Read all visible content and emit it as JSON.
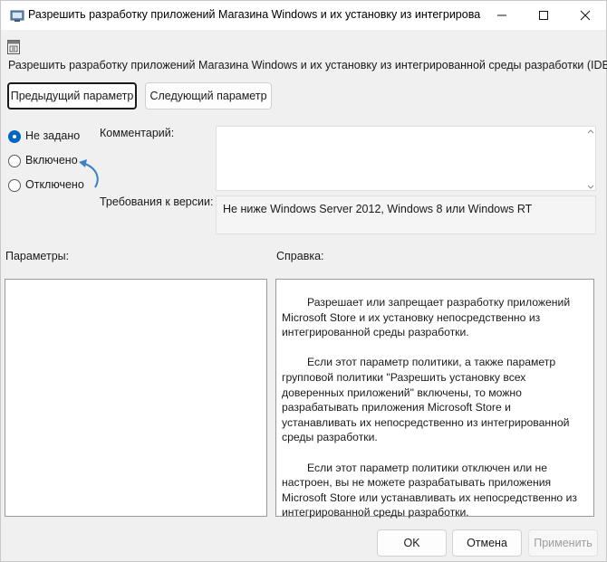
{
  "window": {
    "title": "Разрешить разработку приложений Магазина Windows и их установку из интегрированно..."
  },
  "policy": {
    "heading": "Разрешить разработку приложений Магазина Windows и их установку из интегрированной среды разработки (IDE)"
  },
  "nav": {
    "prev_label": "Предыдущий параметр",
    "next_label": "Следующий параметр"
  },
  "state": {
    "options": [
      {
        "label": "Не задано",
        "checked": true
      },
      {
        "label": "Включено",
        "checked": false
      },
      {
        "label": "Отключено",
        "checked": false
      }
    ]
  },
  "comment": {
    "label": "Комментарий:",
    "value": ""
  },
  "version": {
    "label": "Требования к версии:",
    "value": "Не ниже Windows Server 2012, Windows 8 или Windows RT"
  },
  "params": {
    "label": "Параметры:"
  },
  "help": {
    "label": "Справка:",
    "paragraphs": [
      "Разрешает или запрещает разработку приложений Microsoft Store и их установку непосредственно из интегрированной среды разработки.",
      "Если этот параметр политики, а также параметр групповой политики \"Разрешить установку всех доверенных приложений\" включены, то можно разрабатывать приложения Microsoft Store и устанавливать их непосредственно из интегрированной среды разработки.",
      "Если этот параметр политики отключен или не настроен, вы не можете разрабатывать приложения Microsoft Store или устанавливать их непосредственно из интегрированной среды разработки."
    ]
  },
  "footer": {
    "ok_label": "OK",
    "cancel_label": "Отмена",
    "apply_label": "Применить"
  },
  "colors": {
    "accent": "#0067c0",
    "annotation_arrow": "#3b7fc4"
  }
}
